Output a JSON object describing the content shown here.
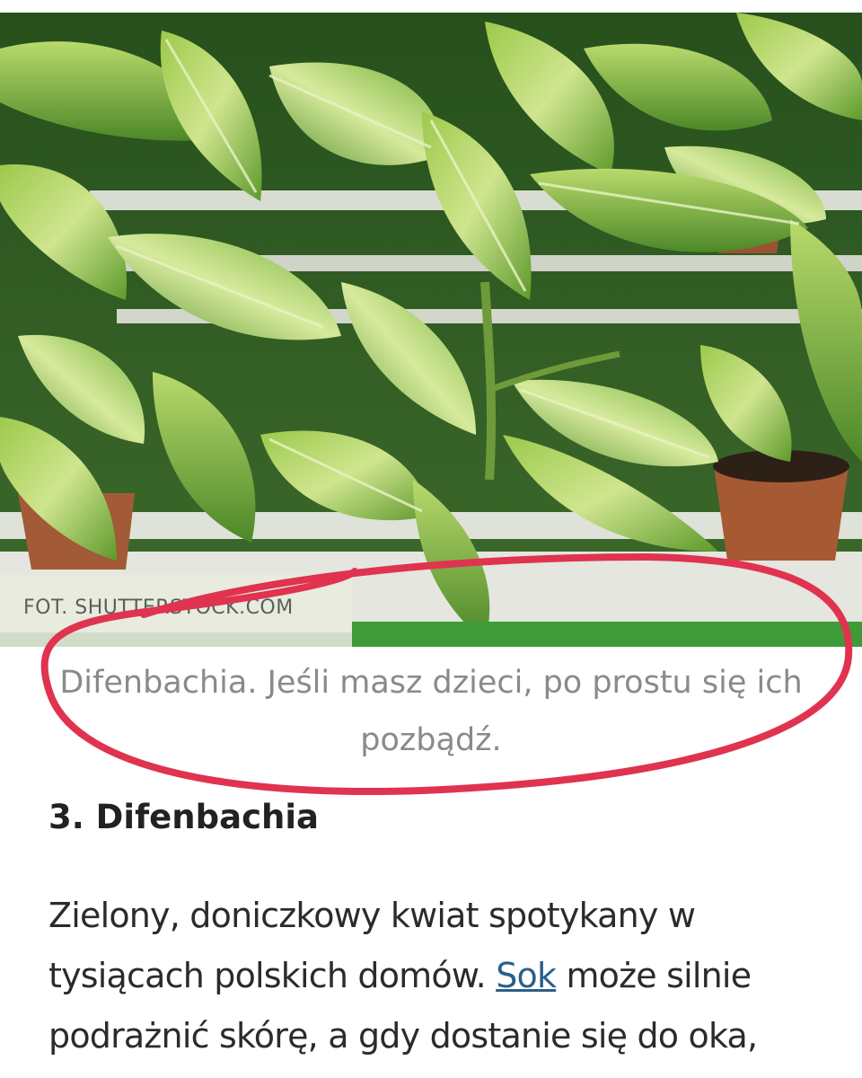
{
  "photo": {
    "credit": "FOT. SHUTTERSTOCK.COM"
  },
  "caption": {
    "line1": "Difenbachia. Jeśli masz dzieci, po prostu się ich",
    "line2": "pozbądź."
  },
  "article": {
    "heading": "3. Difenbachia",
    "body_before_link": "Zielony, doniczkowy kwiat spotykany w tysiącach polskich domów. ",
    "link_text": "Sok",
    "body_after_link": " może silnie podrażnić skórę, a gdy dostanie się do oka,"
  },
  "colors": {
    "annotation_circle": "#e0334f",
    "link": "#2b5f8a",
    "caption_text": "#8a8a8a"
  }
}
